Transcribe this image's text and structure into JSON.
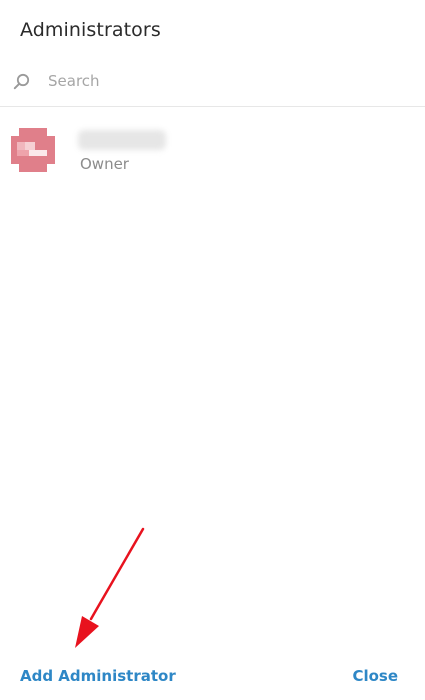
{
  "dialog": {
    "title": "Administrators"
  },
  "search": {
    "placeholder": "Search"
  },
  "administrators": [
    {
      "role": "Owner"
    }
  ],
  "footer": {
    "add_label": "Add Administrator",
    "close_label": "Close"
  },
  "colors": {
    "accent": "#2e87c6",
    "annotation_arrow": "#e8121e",
    "avatar": "#e07f8a"
  },
  "icons": {
    "search": "search-icon"
  }
}
